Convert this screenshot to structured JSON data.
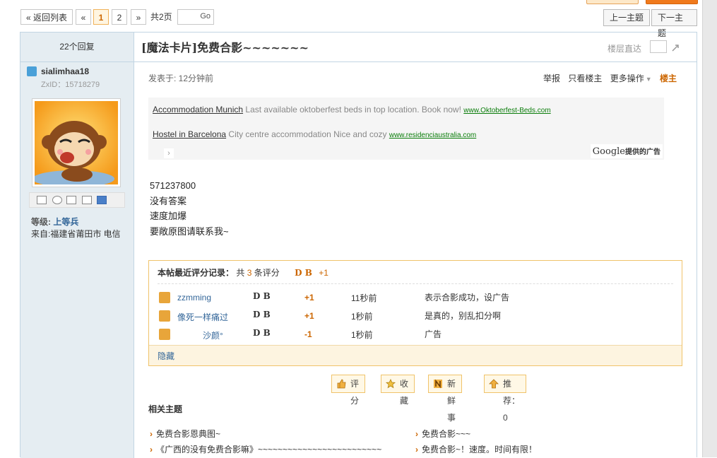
{
  "pager": {
    "back": "« 返回列表",
    "prev": "«",
    "pages": [
      "1",
      "2"
    ],
    "next": "»",
    "total": "共2页",
    "go": "Go"
  },
  "nav": {
    "prev_topic": "上一主题",
    "next_topic": "下一主题"
  },
  "thread": {
    "reply_count": "22个回复",
    "title": "[魔法卡片]免费合影~~~~~~~",
    "jump_label": "楼层直达"
  },
  "author": {
    "name": "sialimhaa18",
    "zxid": "ZxID：15718279",
    "level_label": "等级:",
    "level": "上等兵",
    "from": "来自:福建省莆田市 电信"
  },
  "post": {
    "meta": "发表于: 12分钟前",
    "actions": {
      "report": "举报",
      "only_author": "只看楼主",
      "more": "更多操作",
      "owner": "楼主"
    },
    "body": [
      "571237800",
      "没有答案",
      "速度加爆",
      "要敞原图请联系我~"
    ]
  },
  "ads": {
    "items": [
      {
        "title": "Accommodation Munich",
        "desc": "Last available oktoberfest beds in top location. Book now!",
        "url": "www.Oktoberfest-Beds.com"
      },
      {
        "title": "Hostel in Barcelona",
        "desc": "City centre accommodation Nice and cozy",
        "url": "www.residenciaustralia.com"
      }
    ],
    "google": "Google",
    "google_suffix": "提供的广告"
  },
  "ratings": {
    "title": "本帖最近评分记录：",
    "summary_prefix": "共",
    "count": "3",
    "summary_suffix": "条评分",
    "db": "D B",
    "total": "+1",
    "rows": [
      {
        "user": "zzmming",
        "db": "D B",
        "score": "+1",
        "time": "11秒前",
        "reason": "表示合影成功，设广告"
      },
      {
        "user": "像死一样痛过",
        "db": "D B",
        "score": "+1",
        "time": "1秒前",
        "reason": "是真的，别乱扣分啊"
      },
      {
        "user": "沙颜°",
        "db": "D B",
        "score": "-1",
        "time": "1秒前",
        "reason": "广告"
      }
    ],
    "hide": "隐藏"
  },
  "buttons": {
    "rate": "评分",
    "fav": "收藏",
    "fresh": "新鲜事",
    "recommend": "推荐：0"
  },
  "related": {
    "title": "相关主题",
    "items": [
      "免费合影恩典图~",
      "免费合影~~~",
      "《广西的没有免费合影嘛》~~~~~~~~~~~~~~~~~~~~~~~~~",
      "免费合影~！速度。时间有限！"
    ]
  },
  "colors": {
    "accent": "#cc6600",
    "link": "#336699",
    "border": "#c2d5e3",
    "sidebar": "#e5edf2"
  }
}
